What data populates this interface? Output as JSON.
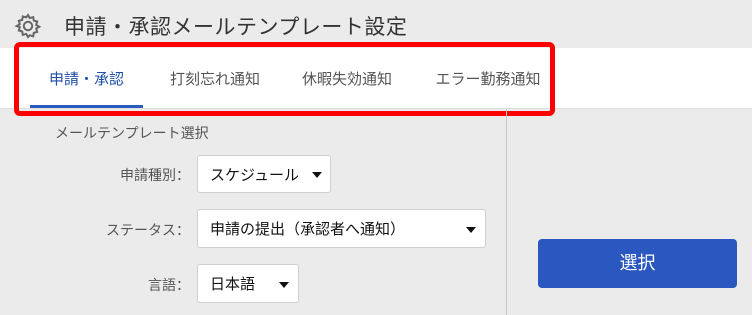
{
  "header": {
    "title": "申請・承認メールテンプレート設定",
    "icon": "gear-icon"
  },
  "tabs": [
    {
      "label": "申請・承認",
      "active": true
    },
    {
      "label": "打刻忘れ通知",
      "active": false
    },
    {
      "label": "休暇失効通知",
      "active": false
    },
    {
      "label": "エラー勤務通知",
      "active": false
    }
  ],
  "form": {
    "section_title": "メールテンプレート選択",
    "type_label": "申請種別：",
    "type_value": "スケジュール",
    "status_label": "ステータス：",
    "status_value": "申請の提出（承認者へ通知）",
    "language_label": "言語：",
    "language_value": "日本語"
  },
  "actions": {
    "select_label": "選択"
  },
  "colors": {
    "accent": "#2a58c0",
    "highlight": "#ff0000",
    "background": "#ebebeb"
  }
}
